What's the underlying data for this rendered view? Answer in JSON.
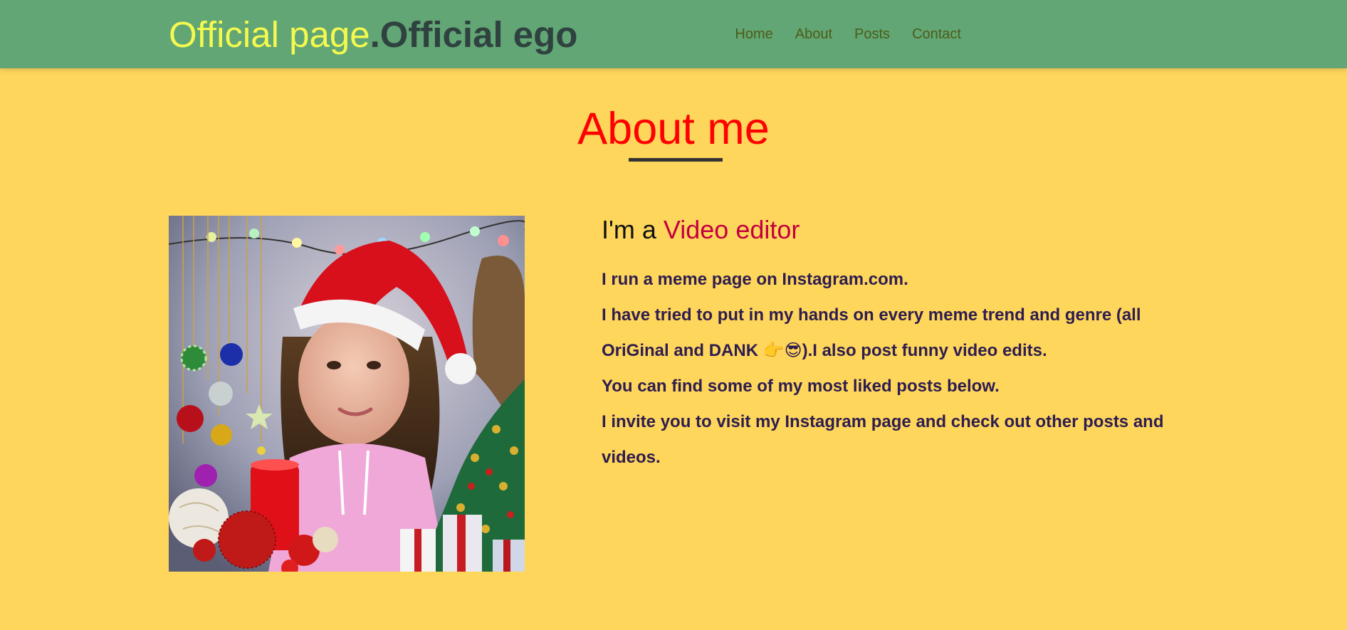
{
  "header": {
    "logo_part1": "Official page",
    "logo_part2": ".Official ego",
    "nav": [
      {
        "label": "Home"
      },
      {
        "label": "About"
      },
      {
        "label": "Posts"
      },
      {
        "label": "Contact"
      }
    ]
  },
  "about": {
    "title": "About me",
    "role_prefix": "I'm a ",
    "role_highlight": "Video editor",
    "paragraphs": [
      "I run a meme page on Instagram.com.",
      "I have tried to put in my hands on every meme trend and genre (all OriGinal and DANK 👉😎).I also post funny video edits.",
      "You can find some of my most liked posts below.",
      "I invite you to visit my Instagram page and check out other posts and videos."
    ]
  },
  "colors": {
    "page_bg": "#fed65b",
    "navbar_bg": "#61a674",
    "logo_accent": "#f4f950",
    "title": "#ff0000",
    "role_highlight": "#c3003f",
    "body_text": "#2e1d4f"
  },
  "icons": [
    "pointing-hand-icon",
    "sunglasses-face-icon"
  ]
}
